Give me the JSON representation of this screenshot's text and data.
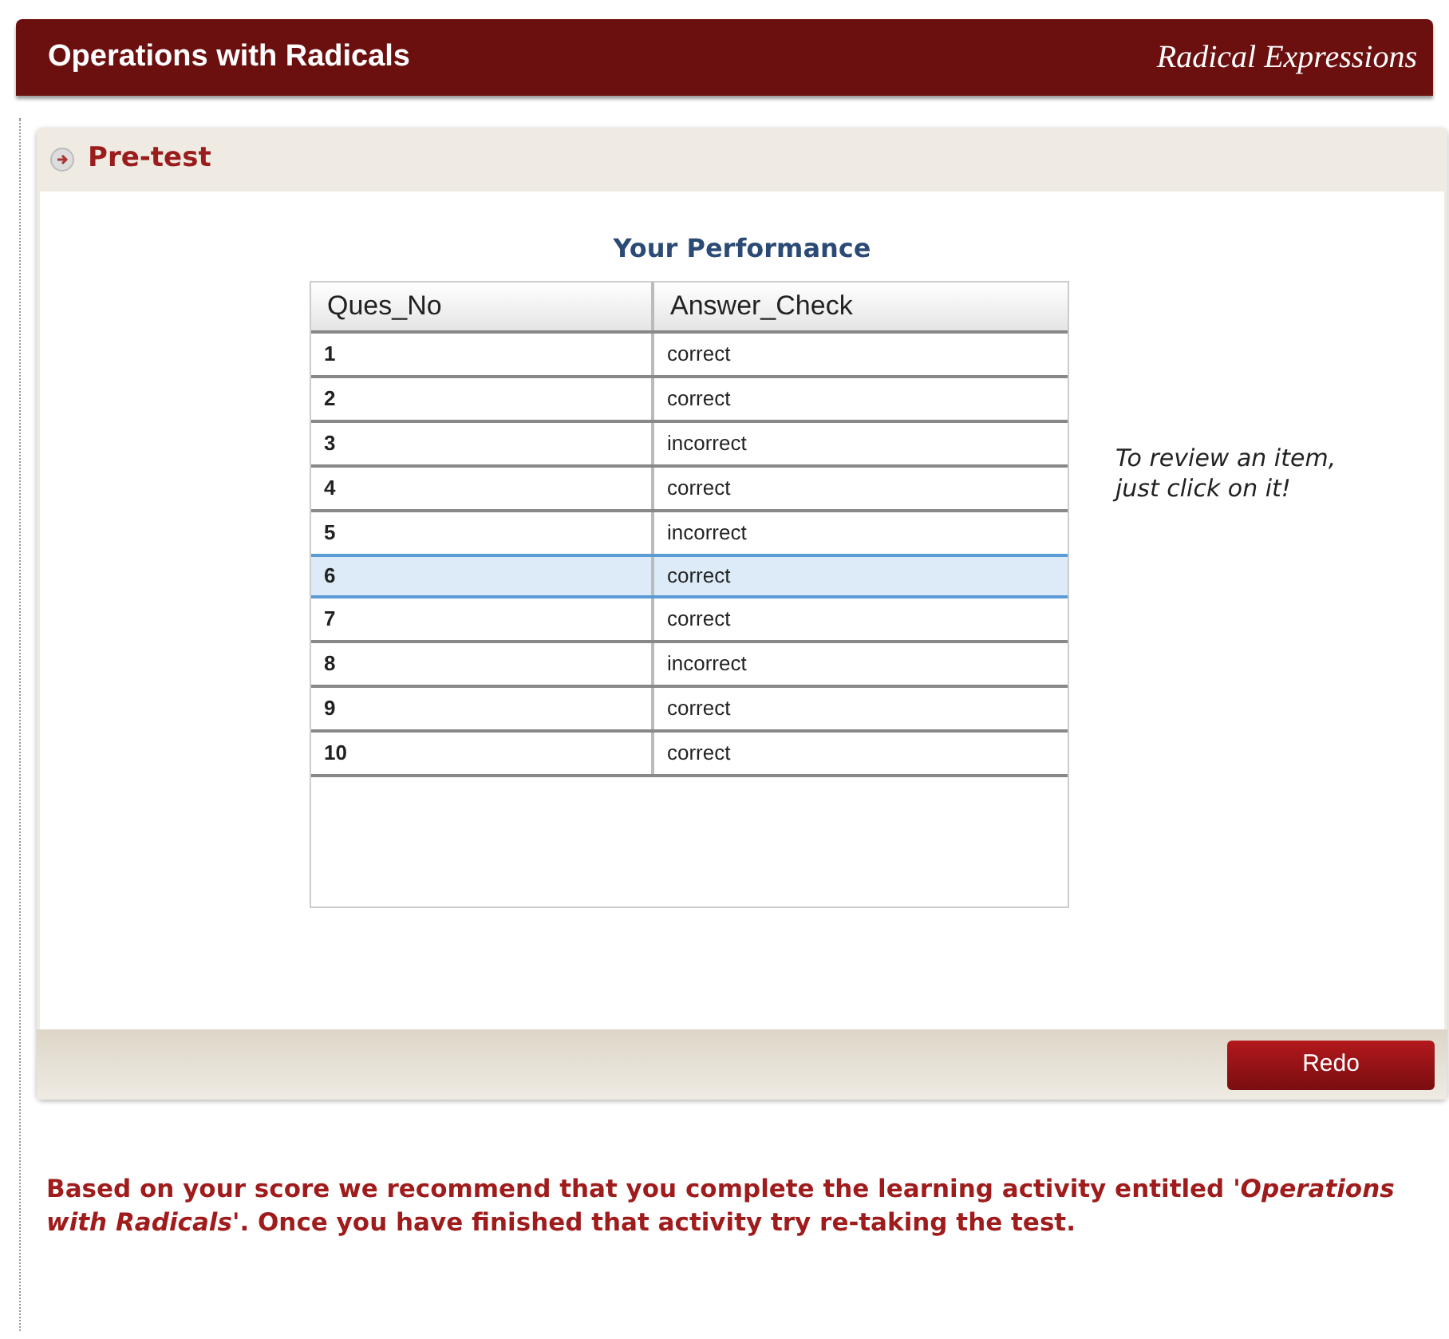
{
  "header": {
    "title": "Operations with Radicals",
    "subtitle": "Radical Expressions"
  },
  "section": {
    "title": "Pre-test"
  },
  "performance": {
    "title": "Your Performance",
    "columns": [
      "Ques_No",
      "Answer_Check"
    ],
    "rows": [
      {
        "number": "1",
        "result": "correct",
        "selected": false
      },
      {
        "number": "2",
        "result": "correct",
        "selected": false
      },
      {
        "number": "3",
        "result": "incorrect",
        "selected": false
      },
      {
        "number": "4",
        "result": "correct",
        "selected": false
      },
      {
        "number": "5",
        "result": "incorrect",
        "selected": false
      },
      {
        "number": "6",
        "result": "correct",
        "selected": true
      },
      {
        "number": "7",
        "result": "correct",
        "selected": false
      },
      {
        "number": "8",
        "result": "incorrect",
        "selected": false
      },
      {
        "number": "9",
        "result": "correct",
        "selected": false
      },
      {
        "number": "10",
        "result": "correct",
        "selected": false
      }
    ],
    "hint": "To review an item, just click on it!"
  },
  "redo_button": "Redo",
  "recommendation": "Based on your score we recommend that you complete the learning activity entitled *'Operations with Radicals'*. Once you have finished that activity try re-taking the test."
}
